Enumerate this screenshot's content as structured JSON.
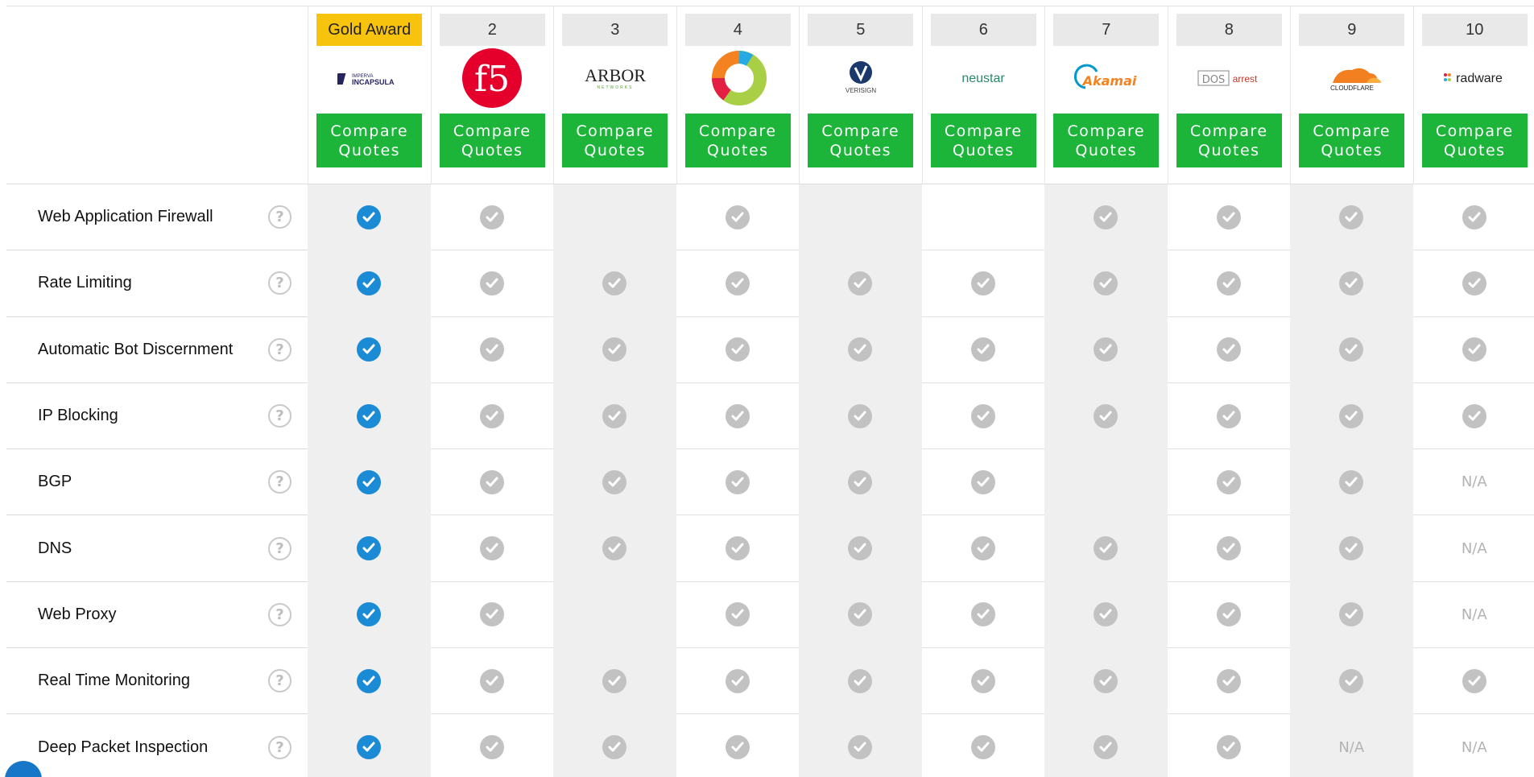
{
  "check_symbol": "✔",
  "colors": {
    "compare_button": "#1cb53a",
    "gold_award": "#f8c30c",
    "check_blue": "#1b8bd6",
    "check_grey": "#c2c2c2"
  },
  "vendors": [
    {
      "rank": "Gold Award",
      "name": "IMPERVA INCAPSULA",
      "compare": "Compare\nQuotes"
    },
    {
      "rank": "2",
      "name": "f5",
      "compare": "Compare\nQuotes"
    },
    {
      "rank": "3",
      "name": "ARBOR",
      "compare": "Compare\nQuotes"
    },
    {
      "rank": "4",
      "name": "",
      "compare": "Compare\nQuotes"
    },
    {
      "rank": "5",
      "name": "VERISIGN",
      "compare": "Compare\nQuotes"
    },
    {
      "rank": "6",
      "name": "neustar",
      "compare": "Compare\nQuotes"
    },
    {
      "rank": "7",
      "name": "Akamai",
      "compare": "Compare\nQuotes"
    },
    {
      "rank": "8",
      "name": "DOSarrest",
      "compare": "Compare\nQuotes"
    },
    {
      "rank": "9",
      "name": "CLOUDFLARE",
      "compare": "Compare\nQuotes"
    },
    {
      "rank": "10",
      "name": "radware",
      "compare": "Compare\nQuotes"
    }
  ],
  "features": [
    {
      "label": "Web Application Firewall",
      "values": [
        "check",
        "check",
        "",
        "check",
        "",
        "",
        "check",
        "check",
        "check",
        "check"
      ]
    },
    {
      "label": "Rate Limiting",
      "values": [
        "check",
        "check",
        "check",
        "check",
        "check",
        "check",
        "check",
        "check",
        "check",
        "check"
      ]
    },
    {
      "label": "Automatic Bot Discernment",
      "values": [
        "check",
        "check",
        "check",
        "check",
        "check",
        "check",
        "check",
        "check",
        "check",
        "check"
      ]
    },
    {
      "label": "IP Blocking",
      "values": [
        "check",
        "check",
        "check",
        "check",
        "check",
        "check",
        "check",
        "check",
        "check",
        "check"
      ]
    },
    {
      "label": "BGP",
      "values": [
        "check",
        "check",
        "check",
        "check",
        "check",
        "check",
        "",
        "check",
        "check",
        "N/A"
      ]
    },
    {
      "label": "DNS",
      "values": [
        "check",
        "check",
        "check",
        "check",
        "check",
        "check",
        "check",
        "check",
        "check",
        "N/A"
      ]
    },
    {
      "label": "Web Proxy",
      "values": [
        "check",
        "check",
        "",
        "check",
        "check",
        "check",
        "check",
        "check",
        "check",
        "N/A"
      ]
    },
    {
      "label": "Real Time Monitoring",
      "values": [
        "check",
        "check",
        "check",
        "check",
        "check",
        "check",
        "check",
        "check",
        "check",
        "check"
      ]
    },
    {
      "label": "Deep Packet Inspection",
      "values": [
        "check",
        "check",
        "check",
        "check",
        "check",
        "check",
        "check",
        "check",
        "N/A",
        "N/A"
      ]
    }
  ]
}
